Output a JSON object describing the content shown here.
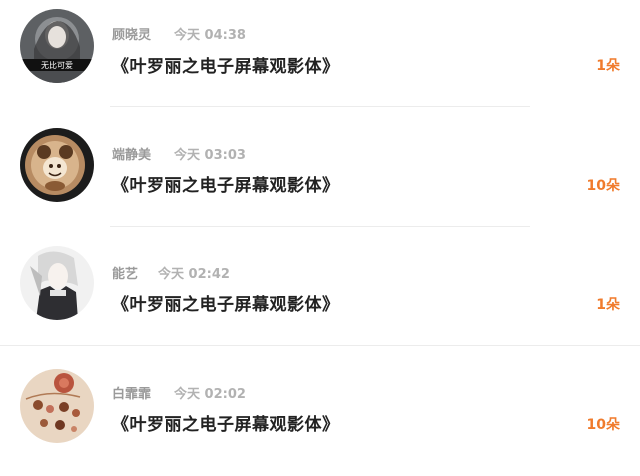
{
  "gifts": [
    {
      "user": "顾晓灵",
      "time": "今天 04:38",
      "title": "《叶罗丽之电子屏幕观影体》",
      "count": "1朵",
      "avatar": "avatar-1",
      "avatar_caption": "无比可爱"
    },
    {
      "user": "端静美",
      "time": "今天 03:03",
      "title": "《叶罗丽之电子屏幕观影体》",
      "count": "10朵",
      "avatar": "avatar-2"
    },
    {
      "user": "能艺",
      "time": "今天 02:42",
      "title": "《叶罗丽之电子屏幕观影体》",
      "count": "1朵",
      "avatar": "avatar-3"
    },
    {
      "user": "白霏霏",
      "time": "今天 02:02",
      "title": "《叶罗丽之电子屏幕观影体》",
      "count": "10朵",
      "avatar": "avatar-4"
    }
  ],
  "colors": {
    "accent": "#f07b2c",
    "username": "#9a9a9a",
    "time": "#b2b2b2",
    "title": "#222222",
    "divider": "#ececec"
  }
}
